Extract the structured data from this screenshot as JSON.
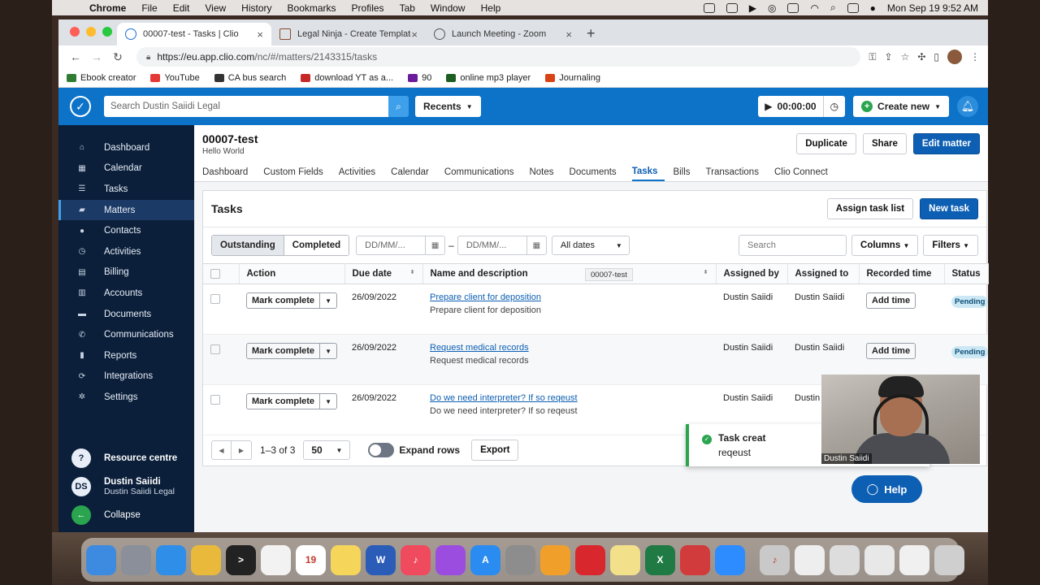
{
  "menubar": {
    "items": [
      "Chrome",
      "File",
      "Edit",
      "View",
      "History",
      "Bookmarks",
      "Profiles",
      "Tab",
      "Window",
      "Help"
    ],
    "datetime": "Mon Sep 19  9:52 AM"
  },
  "browser": {
    "tabs": [
      {
        "title": "00007-test - Tasks | Clio"
      },
      {
        "title": "Legal Ninja - Create Template"
      },
      {
        "title": "Launch Meeting - Zoom"
      }
    ],
    "url_host": "https://eu.app.clio.com",
    "url_path": "/nc/#/matters/2143315/tasks",
    "bookmarks": [
      {
        "label": "Ebook creator",
        "color": "#2e7d32"
      },
      {
        "label": "YouTube",
        "color": "#e53935"
      },
      {
        "label": "CA bus search",
        "color": "#333333"
      },
      {
        "label": "download YT as a...",
        "color": "#c62828"
      },
      {
        "label": "90",
        "color": "#6a1b9a"
      },
      {
        "label": "online mp3 player",
        "color": "#1b5e20"
      },
      {
        "label": "Journaling",
        "color": "#d84315"
      }
    ]
  },
  "clio": {
    "search_placeholder": "Search Dustin Saiidi Legal",
    "recents_label": "Recents",
    "timer": "00:00:00",
    "create_new": "Create new",
    "sidebar": [
      {
        "icon": "home-icon",
        "glyph": "⌂",
        "label": "Dashboard"
      },
      {
        "icon": "calendar-icon",
        "glyph": "▦",
        "label": "Calendar"
      },
      {
        "icon": "tasks-icon",
        "glyph": "☰",
        "label": "Tasks"
      },
      {
        "icon": "briefcase-icon",
        "glyph": "▰",
        "label": "Matters"
      },
      {
        "icon": "contacts-icon",
        "glyph": "●",
        "label": "Contacts"
      },
      {
        "icon": "clock-icon",
        "glyph": "◷",
        "label": "Activities"
      },
      {
        "icon": "billing-icon",
        "glyph": "▤",
        "label": "Billing"
      },
      {
        "icon": "bank-icon",
        "glyph": "▥",
        "label": "Accounts"
      },
      {
        "icon": "folder-icon",
        "glyph": "▬",
        "label": "Documents"
      },
      {
        "icon": "phone-icon",
        "glyph": "✆",
        "label": "Communications"
      },
      {
        "icon": "chart-icon",
        "glyph": "▮",
        "label": "Reports"
      },
      {
        "icon": "sync-icon",
        "glyph": "⟳",
        "label": "Integrations"
      },
      {
        "icon": "gear-icon",
        "glyph": "✲",
        "label": "Settings"
      }
    ],
    "resource_centre": "Resource centre",
    "user_initials": "DS",
    "user_name": "Dustin Saiidi",
    "user_firm": "Dustin Saiidi Legal",
    "collapse": "Collapse"
  },
  "matter": {
    "title": "00007-test",
    "subtitle": "Hello World",
    "duplicate": "Duplicate",
    "share": "Share",
    "edit": "Edit matter",
    "tabs": [
      "Dashboard",
      "Custom Fields",
      "Activities",
      "Calendar",
      "Communications",
      "Notes",
      "Documents",
      "Tasks",
      "Bills",
      "Transactions",
      "Clio Connect"
    ]
  },
  "tasks": {
    "title": "Tasks",
    "assign_task_list": "Assign task list",
    "new_task": "New task",
    "outstanding": "Outstanding",
    "completed": "Completed",
    "date_placeholder": "DD/MM/...",
    "all_dates": "All dates",
    "search_placeholder": "Search",
    "columns": "Columns",
    "filters": "Filters",
    "headers": [
      "Action",
      "Due date",
      "Name and description",
      "Assigned by",
      "Assigned to",
      "Recorded time",
      "Status"
    ],
    "rows": [
      {
        "action": "Mark complete",
        "due": "26/09/2022",
        "name": "Prepare client for deposition",
        "desc": "Prepare client for deposition",
        "by": "Dustin Saiidi",
        "to": "Dustin Saiidi",
        "time": "Add time",
        "status": "Pending"
      },
      {
        "action": "Mark complete",
        "due": "26/09/2022",
        "name": "Request medical records",
        "desc": "Request medical records",
        "by": "Dustin Saiidi",
        "to": "Dustin Saiidi",
        "time": "Add time",
        "status": "Pending"
      },
      {
        "action": "Mark complete",
        "due": "26/09/2022",
        "name": "Do we need interpreter? If so reqeust",
        "desc": "Do we need interpreter? If so reqeust",
        "by": "Dustin Saiidi",
        "to": "Dustin",
        "time": "",
        "status": ""
      }
    ],
    "pagination": "1–3 of 3",
    "per_page": "50",
    "expand_rows": "Expand rows",
    "export": "Export"
  },
  "tooltip": "00007-test",
  "toast": {
    "line1": "Task creat",
    "line2": "reqeust"
  },
  "video_label": "Dustin Saiidi",
  "help": "Help",
  "dock": [
    {
      "name": "finder-icon",
      "color": "#3d8be0",
      "glyph": ""
    },
    {
      "name": "launchpad-icon",
      "color": "#8a8f99",
      "glyph": ""
    },
    {
      "name": "safari-icon",
      "color": "#2f8ee8",
      "glyph": ""
    },
    {
      "name": "chrome-icon",
      "color": "#e8b93a",
      "glyph": ""
    },
    {
      "name": "terminal-icon",
      "color": "#222222",
      "glyph": ">"
    },
    {
      "name": "photos-icon",
      "color": "#f2f2f2",
      "glyph": ""
    },
    {
      "name": "calendar-icon",
      "color": "#ffffff",
      "glyph": "19"
    },
    {
      "name": "notes-icon",
      "color": "#f5d55a",
      "glyph": ""
    },
    {
      "name": "word-icon",
      "color": "#2b5cb8",
      "glyph": "W"
    },
    {
      "name": "music-icon",
      "color": "#f04a5e",
      "glyph": "♪"
    },
    {
      "name": "podcasts-icon",
      "color": "#9b4de0",
      "glyph": ""
    },
    {
      "name": "appstore-icon",
      "color": "#2a8cf0",
      "glyph": "A"
    },
    {
      "name": "settings-icon",
      "color": "#8d8d8d",
      "glyph": ""
    },
    {
      "name": "pinwheel-icon",
      "color": "#f0a02a",
      "glyph": ""
    },
    {
      "name": "acrobat-icon",
      "color": "#d9272e",
      "glyph": ""
    },
    {
      "name": "stickies-icon",
      "color": "#f2e08a",
      "glyph": ""
    },
    {
      "name": "excel-icon",
      "color": "#1f7a44",
      "glyph": "X"
    },
    {
      "name": "anyconnect-icon",
      "color": "#d13b3b",
      "glyph": ""
    },
    {
      "name": "zoom-icon",
      "color": "#2d8cff",
      "glyph": ""
    },
    {
      "name": "itunes-icon",
      "color": "#c9c9c9",
      "glyph": "♪"
    },
    {
      "name": "doc-thumb-icon",
      "color": "#eeeeee",
      "glyph": ""
    },
    {
      "name": "doc-thumb-icon",
      "color": "#dddddd",
      "glyph": ""
    },
    {
      "name": "doc-thumb-icon",
      "color": "#e8e8e8",
      "glyph": ""
    },
    {
      "name": "doc-thumb-icon",
      "color": "#f0f0f0",
      "glyph": ""
    },
    {
      "name": "trash-icon",
      "color": "#cfcfcf",
      "glyph": ""
    }
  ]
}
